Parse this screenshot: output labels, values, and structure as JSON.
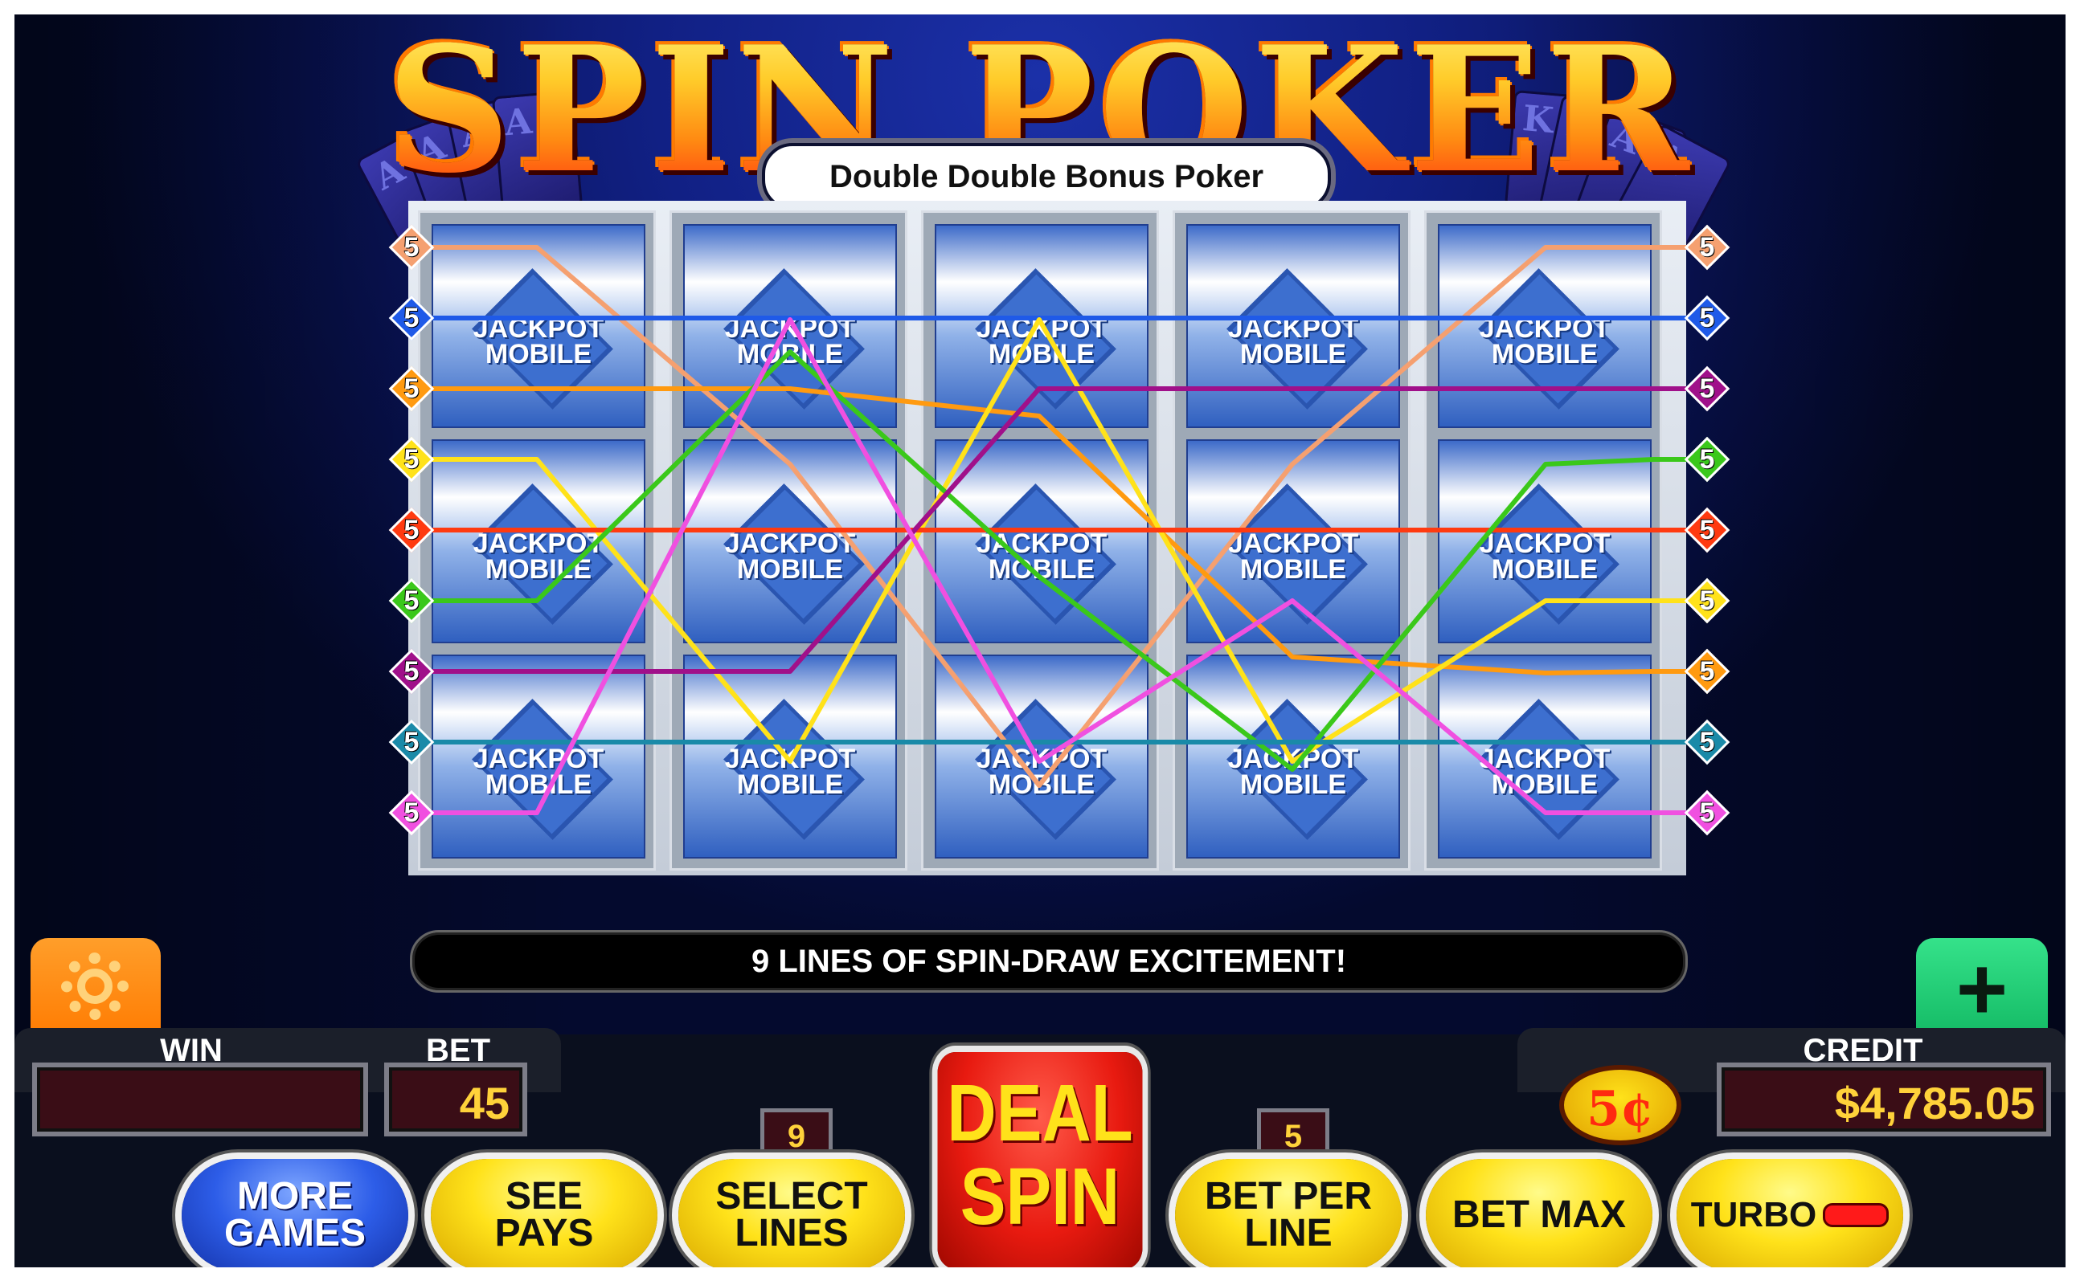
{
  "game": {
    "title": "SPIN POKER",
    "subtitle": "Double Double Bonus Poker",
    "banner": "9 LINES OF SPIN-DRAW EXCITEMENT!"
  },
  "card_back": {
    "line1": "JACKPOT",
    "line2": "MOBILE"
  },
  "fan_cards": {
    "left": [
      "A",
      "A",
      "A",
      "A"
    ],
    "right": [
      "K",
      "K",
      "A",
      "A"
    ]
  },
  "paylines": {
    "count": 9,
    "marker_value": "5",
    "lines": [
      {
        "color": "#f5a070",
        "left_row": 1,
        "right_row": 1
      },
      {
        "color": "#1f5ae8",
        "left_row": 2,
        "right_row": 2
      },
      {
        "color": "#ff9a10",
        "left_row": 3,
        "right_row": 7
      },
      {
        "color": "#ffe21a",
        "left_row": 4,
        "right_row": 6
      },
      {
        "color": "#ff3a10",
        "left_row": 5,
        "right_row": 5
      },
      {
        "color": "#3ac81a",
        "left_row": 6,
        "right_row": 4
      },
      {
        "color": "#a0108a",
        "left_row": 7,
        "right_row": 3
      },
      {
        "color": "#1a8aa8",
        "left_row": 8,
        "right_row": 8
      },
      {
        "color": "#f050e0",
        "left_row": 9,
        "right_row": 9
      }
    ]
  },
  "panel": {
    "win_label": "WIN",
    "win_value": "",
    "bet_label": "BET",
    "bet_value": "45",
    "lines_value": "9",
    "bet_per_line_value": "5",
    "denomination": "5¢",
    "credit_label": "CREDIT",
    "credit_value": "$4,785.05"
  },
  "buttons": {
    "more_games": [
      "MORE",
      "GAMES"
    ],
    "see_pays": [
      "SEE",
      "PAYS"
    ],
    "select_lines": [
      "SELECT",
      "LINES"
    ],
    "deal_spin": [
      "DEAL",
      "SPIN"
    ],
    "bet_per_line": [
      "BET PER",
      "LINE"
    ],
    "bet_max": "BET MAX",
    "turbo": "TURBO",
    "settings_icon": "gear-icon",
    "add_credit_icon": "plus-icon"
  },
  "colors": {
    "background": "#112084",
    "button_yellow": "#ffe21a",
    "button_blue": "#2d5de8",
    "deal_red": "#e81a10",
    "settings_orange": "#ff8a10",
    "add_green": "#20c870"
  }
}
